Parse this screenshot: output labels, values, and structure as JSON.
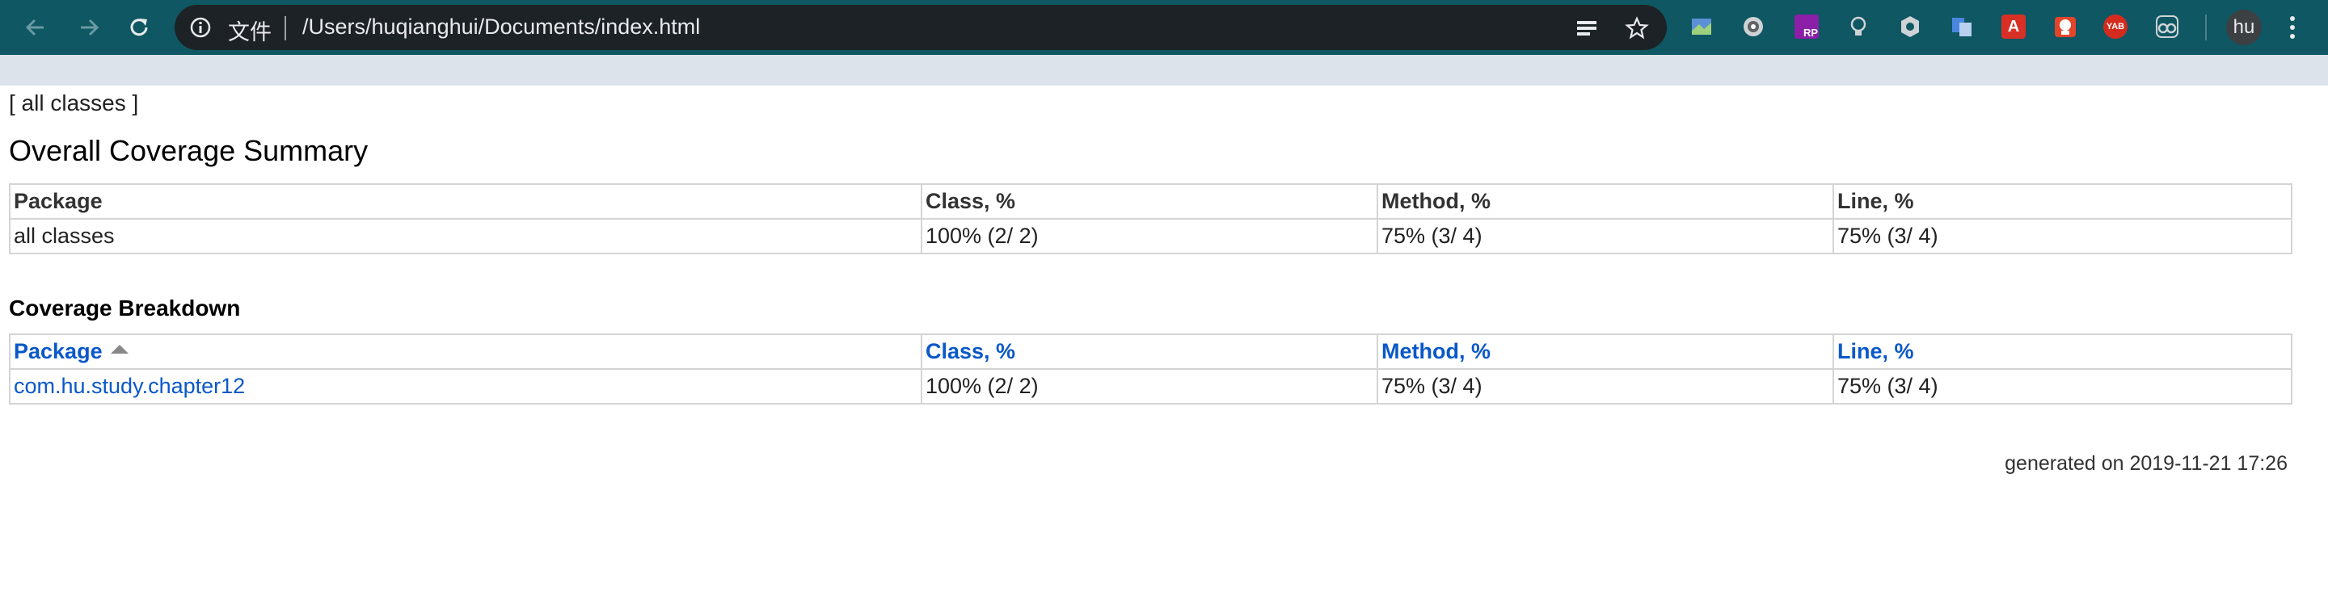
{
  "browser": {
    "url_scheme": "文件",
    "url_path": "/Users/huqianghui/Documents/index.html",
    "profile_initials": "hu",
    "toolbar_color": "#0e5763",
    "extensions": [
      "map-extension-icon",
      "circle-extension-icon",
      "rp-extension-icon",
      "bulb-extension-icon",
      "gear-extension-icon",
      "translate-extension-icon",
      "a-extension-icon",
      "robot-extension-icon",
      "yab-extension-icon",
      "glasses-extension-icon"
    ],
    "yab_label": "YAB",
    "rp_label": "RP",
    "a_label": "A"
  },
  "page": {
    "breadcrumb": "[ all classes ]",
    "overall_title": "Overall Coverage Summary",
    "overall_table": {
      "headers": [
        "Package",
        "Class, %",
        "Method, %",
        "Line, %"
      ],
      "rows": [
        [
          "all classes",
          "100% (2/ 2)",
          "75% (3/ 4)",
          "75% (3/ 4)"
        ]
      ]
    },
    "breakdown_title": "Coverage Breakdown",
    "breakdown_table": {
      "headers": [
        "Package",
        "Class, %",
        "Method, %",
        "Line, %"
      ],
      "rows": [
        [
          "com.hu.study.chapter12",
          "100% (2/ 2)",
          "75% (3/ 4)",
          "75% (3/ 4)"
        ]
      ]
    },
    "generated": "generated on 2019-11-21 17:26",
    "link_color": "#0a58c9"
  }
}
